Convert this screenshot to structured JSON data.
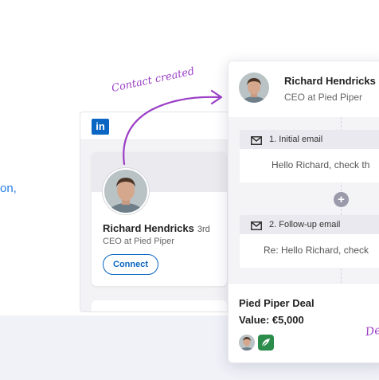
{
  "left_text": "on,",
  "linkedin": {
    "logo": "in",
    "name": "Richard Hendricks",
    "degree": "3rd",
    "title": "CEO at Pied Piper",
    "connect_label": "Connect"
  },
  "annotation": "Contact created",
  "panel": {
    "name": "Richard Hendricks",
    "title": "CEO at Pied Piper",
    "steps": [
      {
        "label": "1. Initial email",
        "preview": "Hello Richard, check th",
        "icon": "envelope-icon"
      },
      {
        "label": "2. Follow-up email",
        "preview": "Re: Hello Richard, check",
        "icon": "envelope-icon"
      }
    ],
    "add_step_icon": "+",
    "deal": {
      "title": "Pied Piper Deal",
      "value_label": "Value:",
      "value": "€5,000",
      "handwritten": "De"
    }
  },
  "colors": {
    "linkedin_blue": "#0a66c2",
    "annotation_purple": "#9b3fc6",
    "accent_blue": "#2a7fe3"
  }
}
